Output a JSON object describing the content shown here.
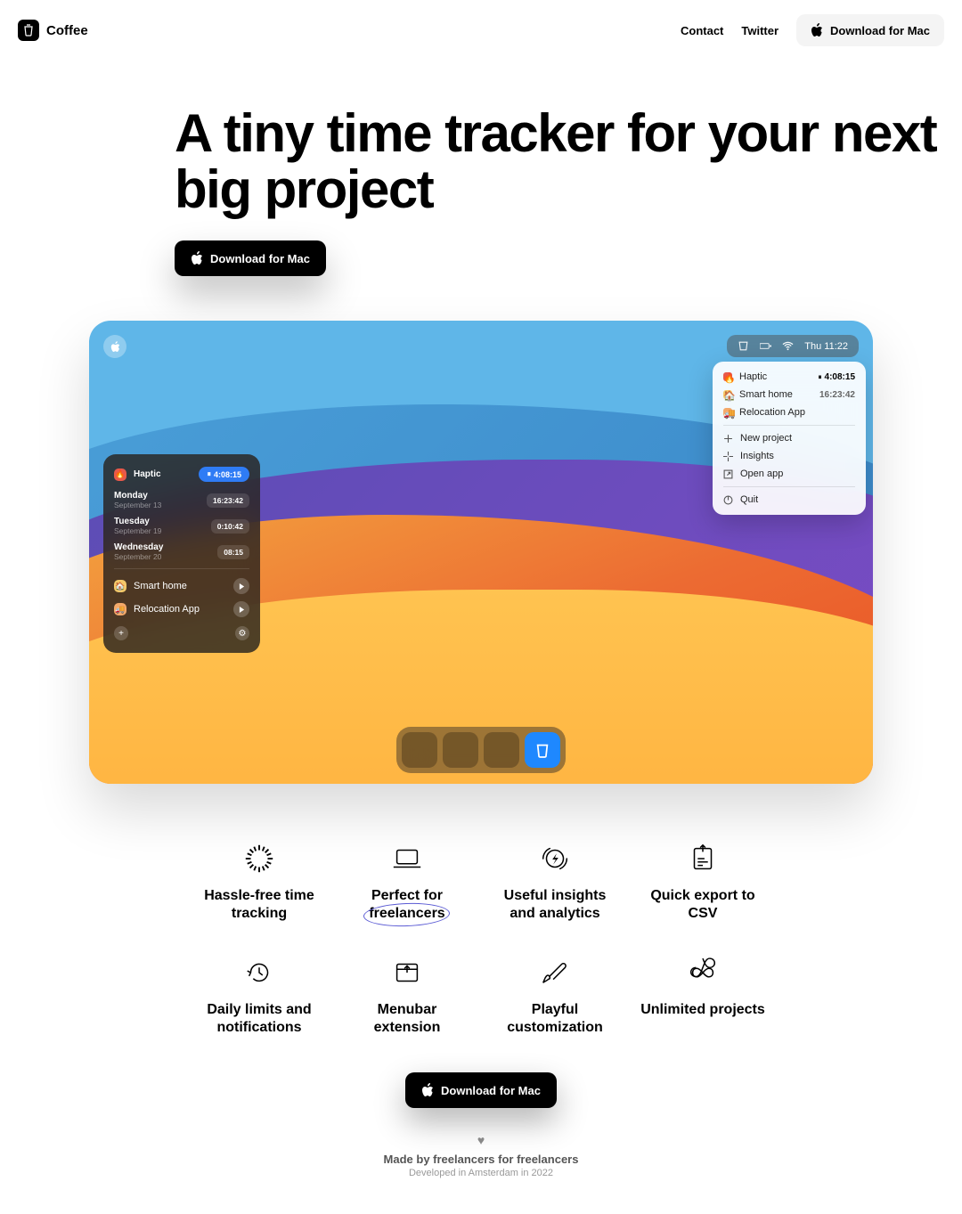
{
  "brand": "Coffee",
  "nav": {
    "contact": "Contact",
    "twitter": "Twitter",
    "download": "Download for Mac"
  },
  "hero": {
    "title": "A tiny time tracker for your next big project",
    "download": "Download for Mac"
  },
  "menubar": {
    "time": "Thu 11:22"
  },
  "menu": {
    "projects": [
      {
        "name": "Haptic",
        "time": "4:08:15",
        "active": true
      },
      {
        "name": "Smart home",
        "time": "16:23:42",
        "active": false
      },
      {
        "name": "Relocation App",
        "time": "",
        "active": false
      }
    ],
    "actions": [
      "New project",
      "Insights",
      "Open app"
    ],
    "quit": "Quit"
  },
  "app": {
    "active": {
      "name": "Haptic",
      "time": "4:08:15"
    },
    "days": [
      {
        "day": "Monday",
        "date": "September 13",
        "time": "16:23:42"
      },
      {
        "day": "Tuesday",
        "date": "September 19",
        "time": "0:10:42"
      },
      {
        "day": "Wednesday",
        "date": "September 20",
        "time": "08:15"
      }
    ],
    "projects": [
      {
        "name": "Smart home"
      },
      {
        "name": "Relocation App"
      }
    ]
  },
  "features": [
    "Hassle-free time tracking",
    "Perfect for freelancers",
    "Useful insights and analytics",
    "Quick export to CSV",
    "Daily limits and notifications",
    "Menubar extension",
    "Playful customization",
    "Unlimited projects"
  ],
  "cta": {
    "download": "Download for Mac"
  },
  "credits": {
    "line1": "Made by freelancers for freelancers",
    "line2": "Developed in Amsterdam in 2022"
  }
}
